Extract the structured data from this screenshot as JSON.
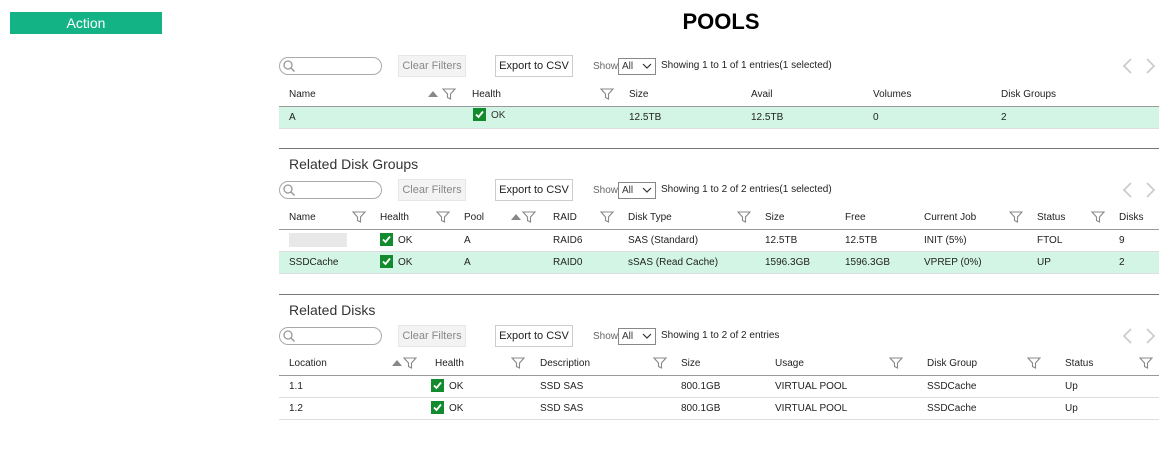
{
  "action_label": "Action",
  "page_title": "POOLS",
  "toolbar": {
    "clear_filters": "Clear Filters",
    "export_csv": "Export to CSV",
    "show_label": "Show",
    "show_value": "All"
  },
  "icons": {
    "search": "search-icon",
    "filter": "filter-icon",
    "sort": "sort-up-icon",
    "check": "check-icon",
    "prev": "chevron-left-icon",
    "next": "chevron-right-icon"
  },
  "colors": {
    "accent": "#14b386",
    "selected_row": "#d2f5e6",
    "ok": "#128a2e"
  },
  "pools": {
    "showing": "Showing 1 to 1 of 1 entries(1 selected)",
    "columns": [
      "Name",
      "Health",
      "Size",
      "Avail",
      "Volumes",
      "Disk Groups"
    ],
    "rows": [
      {
        "name": "A",
        "health": "OK",
        "size": "12.5TB",
        "avail": "12.5TB",
        "volumes": "0",
        "disk_groups": "2"
      }
    ]
  },
  "disk_groups": {
    "title": "Related Disk Groups",
    "showing": "Showing 1 to 2 of 2 entries(1 selected)",
    "columns": [
      "Name",
      "Health",
      "Pool",
      "RAID",
      "Disk Type",
      "Size",
      "Free",
      "Current Job",
      "Status",
      "Disks"
    ],
    "rows": [
      {
        "name": "",
        "health": "OK",
        "pool": "A",
        "raid": "RAID6",
        "disk_type": "SAS (Standard)",
        "size": "12.5TB",
        "free": "12.5TB",
        "job": "INIT (5%)",
        "status": "FTOL",
        "disks": "9"
      },
      {
        "name": "SSDCache",
        "health": "OK",
        "pool": "A",
        "raid": "RAID0",
        "disk_type": "sSAS (Read Cache)",
        "size": "1596.3GB",
        "free": "1596.3GB",
        "job": "VPREP (0%)",
        "status": "UP",
        "disks": "2"
      }
    ]
  },
  "disks": {
    "title": "Related Disks",
    "showing": "Showing 1 to 2 of 2 entries",
    "columns": [
      "Location",
      "Health",
      "Description",
      "Size",
      "Usage",
      "Disk Group",
      "Status"
    ],
    "rows": [
      {
        "location": "1.1",
        "health": "OK",
        "description": "SSD SAS",
        "size": "800.1GB",
        "usage": "VIRTUAL POOL",
        "disk_group": "SSDCache",
        "status": "Up"
      },
      {
        "location": "1.2",
        "health": "OK",
        "description": "SSD SAS",
        "size": "800.1GB",
        "usage": "VIRTUAL POOL",
        "disk_group": "SSDCache",
        "status": "Up"
      }
    ]
  }
}
